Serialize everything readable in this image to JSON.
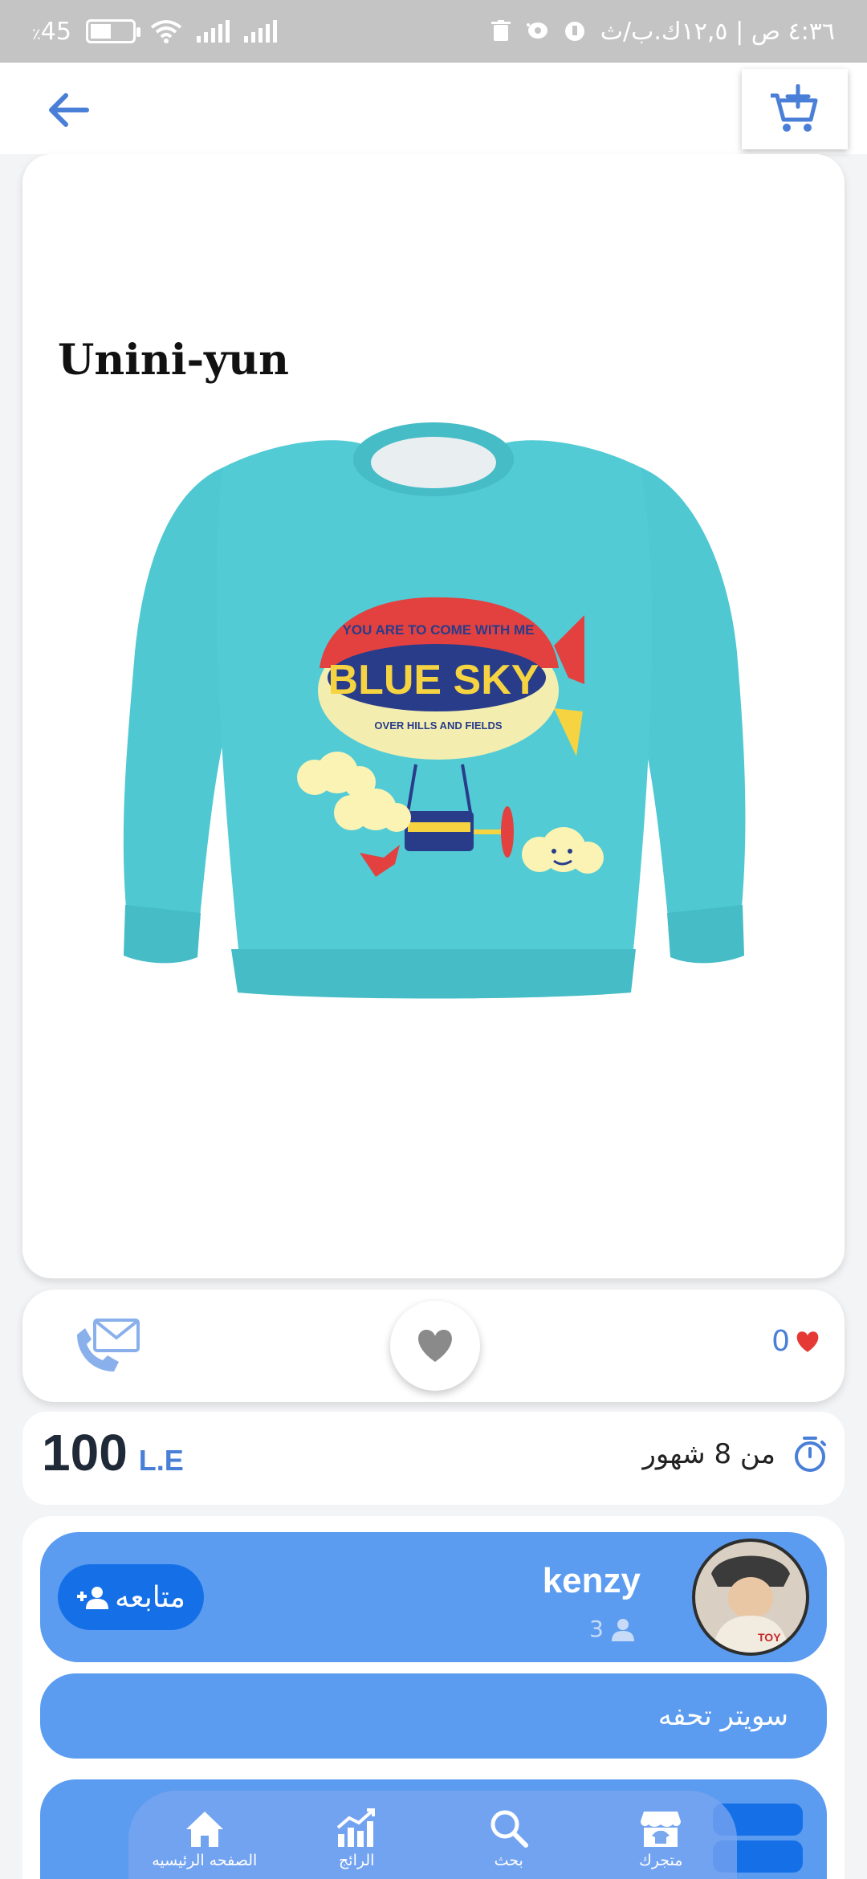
{
  "status_bar": {
    "battery": "45",
    "battery_suffix": "٪",
    "time_info": "٤:٣٦ ص | ١٢,٥ك.ب/ث"
  },
  "product_image": {
    "brand_text": "Unini-yun",
    "print_line1": "YOU ARE TO COME WITH ME",
    "print_title": "BLUE SKY",
    "print_line2": "OVER HILLS AND FIELDS"
  },
  "actions": {
    "likes_count": "0"
  },
  "price": {
    "value": "100",
    "currency": "L.E"
  },
  "age": {
    "label": "من 8 شهور"
  },
  "seller": {
    "name": "kenzy",
    "followers": "3",
    "follow_label": "متابعه"
  },
  "product": {
    "title": "سويتر تحفه"
  },
  "bottom_nav": {
    "items": [
      {
        "label": "متجرك",
        "icon": "store-icon"
      },
      {
        "label": "بحث",
        "icon": "search-icon"
      },
      {
        "label": "الرائج",
        "icon": "trending-icon"
      },
      {
        "label": "الصفحه الرئيسيه",
        "icon": "home-icon"
      }
    ]
  },
  "colors": {
    "primary": "#5b9cf0",
    "primary_dark": "#1570e8",
    "accent_red": "#e53935",
    "sweater": "#4fc8d2"
  }
}
